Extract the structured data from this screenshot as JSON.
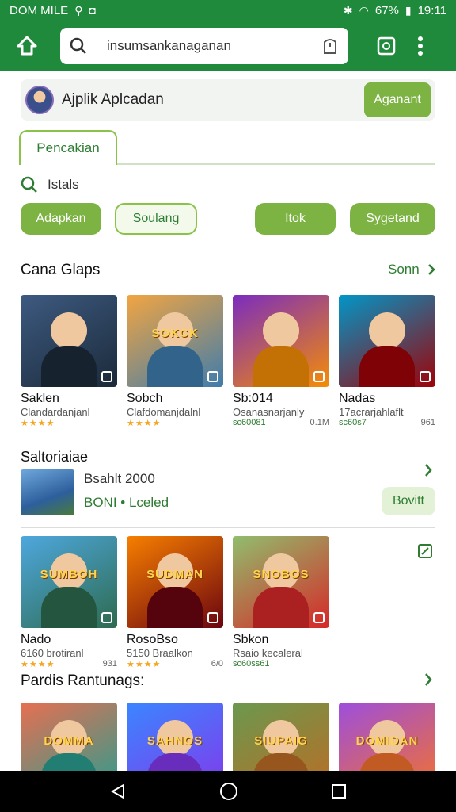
{
  "status_bar": {
    "carrier": "DOM MILE",
    "battery": "67%",
    "time": "19:11"
  },
  "toolbar": {
    "url": "insumsankanaganan",
    "icons": [
      "home-icon",
      "search-icon",
      "bookmark-icon",
      "tabs-icon",
      "more-icon"
    ]
  },
  "app_header": {
    "title": "Ajplik Aplcadan",
    "button": "Aganant"
  },
  "tabs": [
    {
      "label": "Pencakian",
      "active": true
    }
  ],
  "search": {
    "label": "Istals"
  },
  "chips": [
    {
      "label": "Adapkan",
      "style": "filled"
    },
    {
      "label": "Soulang",
      "style": "outline"
    },
    {
      "label": "Itok",
      "style": "filled"
    },
    {
      "label": "Sygetand",
      "style": "filled"
    }
  ],
  "section1": {
    "title": "Cana Glaps",
    "more": "Sonn",
    "cards": [
      {
        "name": "Saklen",
        "sub": "Clandardanjanl",
        "rating": "★★★★",
        "side": "",
        "colors": [
          "#3d5a80",
          "#1b2a3a"
        ],
        "logo": ""
      },
      {
        "name": "Sobch",
        "sub": "Clafdomanjdalnl",
        "rating": "★★★★",
        "side": "",
        "colors": [
          "#f2a541",
          "#3f7cac"
        ],
        "logo": "SOKCK"
      },
      {
        "name": "Sb:014",
        "sub": "Osanasnarjanly",
        "rating": "sc60081",
        "side": "0.1M",
        "colors": [
          "#7b2cbf",
          "#f48c06"
        ],
        "logo": ""
      },
      {
        "name": "Nadas",
        "sub": "17acrarjahlaflt",
        "rating": "sc60s7",
        "side": "961",
        "colors": [
          "#0096c7",
          "#9d0208"
        ],
        "logo": ""
      }
    ]
  },
  "section2": {
    "title": "Saltoriaiae",
    "featured": {
      "title": "Bsahlt 2000",
      "status": "BONI • Lceled",
      "button": "Bovitt"
    }
  },
  "section3": {
    "cards": [
      {
        "name": "Nado",
        "sub": "6160 brotiranl",
        "rating": "★★★★",
        "side": "931",
        "colors": [
          "#4ea8de",
          "#2d6a4f"
        ],
        "logo": "SUMBOH"
      },
      {
        "name": "RosoBso",
        "sub": "5150 Braalkon",
        "rating": "★★★★",
        "side": "6/0",
        "colors": [
          "#f77f00",
          "#6a040f"
        ],
        "logo": "SUDMAN"
      },
      {
        "name": "Sbkon",
        "sub": "Rsaio kecaleral",
        "rating": "sc60ss61",
        "side": "",
        "colors": [
          "#90be6d",
          "#d62828"
        ],
        "logo": "SNOBOS"
      }
    ]
  },
  "section4": {
    "title": "Pardis Rantunags:",
    "cards": [
      {
        "colors": [
          "#e76f51",
          "#2a9d8f"
        ],
        "logo": "DOMMA"
      },
      {
        "colors": [
          "#3a86ff",
          "#8338ec"
        ],
        "logo": "SAHNOS"
      },
      {
        "colors": [
          "#6a994e",
          "#bc6c25"
        ],
        "logo": "SIUPAIG"
      },
      {
        "colors": [
          "#9d4edd",
          "#f3722c"
        ],
        "logo": "DOMIDAN"
      }
    ]
  },
  "nav": {
    "icons": [
      "back-icon",
      "home-circle-icon",
      "recents-icon"
    ]
  }
}
